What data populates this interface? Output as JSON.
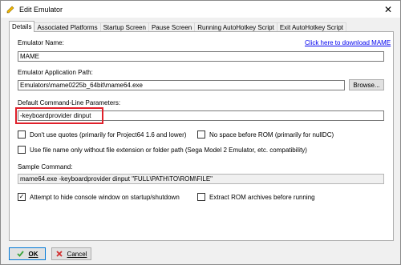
{
  "window": {
    "title": "Edit Emulator",
    "app_icon": "edit-emulator-icon",
    "close_icon": "close-icon"
  },
  "tabs": [
    {
      "label": "Details",
      "active": true
    },
    {
      "label": "Associated Platforms",
      "active": false
    },
    {
      "label": "Startup Screen",
      "active": false
    },
    {
      "label": "Pause Screen",
      "active": false
    },
    {
      "label": "Running AutoHotkey Script",
      "active": false
    },
    {
      "label": "Exit AutoHotkey Script",
      "active": false
    }
  ],
  "details": {
    "emulator_name_label": "Emulator Name:",
    "download_link": "Click here to download MAME",
    "emulator_name_value": "MAME",
    "app_path_label": "Emulator Application Path:",
    "app_path_value": "Emulators\\mame0225b_64bit\\mame64.exe",
    "browse_label": "Browse...",
    "cmdline_label": "Default Command-Line Parameters:",
    "cmdline_value": "-keyboardprovider dinput",
    "checkboxes": [
      {
        "label": "Don't use quotes (primarily for Project64 1.6 and lower)",
        "checked": false
      },
      {
        "label": "No space before ROM (primarily for nullDC)",
        "checked": false
      },
      {
        "label": "Use file name only without file extension or folder path (Sega Model 2 Emulator, etc. compatibility)",
        "checked": false
      }
    ],
    "sample_label": "Sample Command:",
    "sample_value": "mame64.exe -keyboardprovider dinput \"FULL\\PATH\\TO\\ROM\\FILE\"",
    "bottom_checkboxes": [
      {
        "label": "Attempt to hide console window on startup/shutdown",
        "checked": true
      },
      {
        "label": "Extract ROM archives before running",
        "checked": false
      }
    ]
  },
  "footer": {
    "ok_label": "OK",
    "cancel_label": "Cancel",
    "ok_icon": "checkmark-icon",
    "cancel_icon": "cross-icon",
    "colors": {
      "ok_icon": "#3aa33a",
      "cancel_icon": "#d32f2f",
      "highlight": "#e0202a",
      "link": "#0000ee"
    }
  }
}
